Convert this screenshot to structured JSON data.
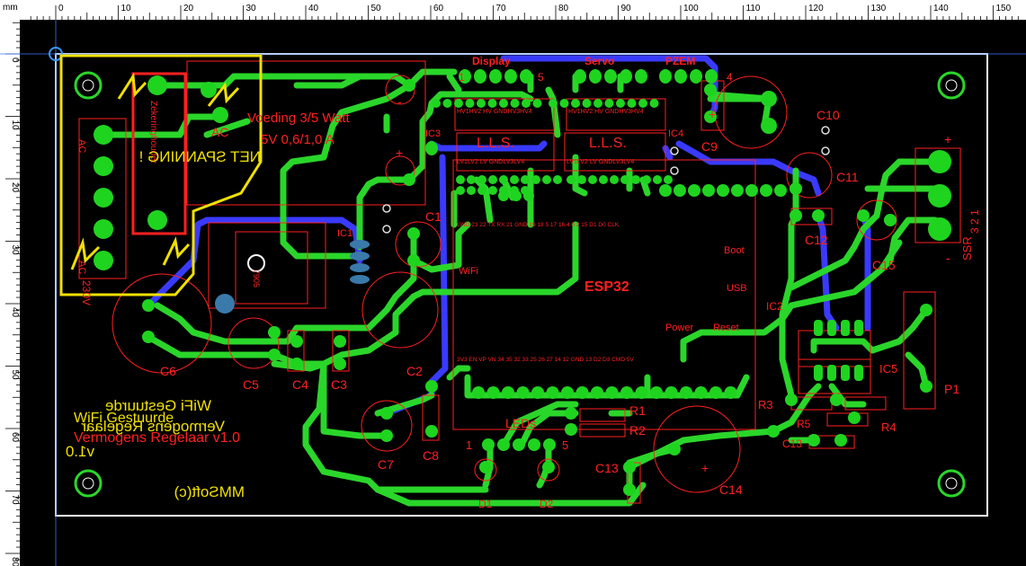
{
  "ruler": {
    "unit": "mm",
    "top_labels": [
      "0",
      "10",
      "20",
      "30",
      "40",
      "50",
      "60",
      "70",
      "80",
      "90",
      "100",
      "110",
      "120",
      "130",
      "140",
      "150"
    ],
    "left_labels": [
      "0",
      "10",
      "20",
      "30",
      "40",
      "50",
      "60",
      "70",
      "80"
    ]
  },
  "colors": {
    "background": "#000000",
    "ruler": "#ffffff",
    "board_outline": "#ffffff",
    "track_top": "#2ad62a",
    "track_bottom": "#3a3aff",
    "silkscreen": "#ff2020",
    "silkscreen_bottom": "#f0e000"
  },
  "icons": {
    "origin_marker": "crosshair-icon"
  },
  "silk": {
    "display": "Display",
    "servo": "Servo",
    "pzem": "PZEM",
    "pin1": "1",
    "pin5": "5",
    "pin4": "4",
    "voeding1": "Voeding 3/5 Watt",
    "voeding2": "5V 0,6/1,0 A",
    "ac_label": "AC",
    "ac_top": "AC",
    "ac_bottom": "AC",
    "zekering": "Zekeringhouder",
    "netspanning": "NET SPANNING !",
    "v230": "230V",
    "ic3": "IC3",
    "ic4": "IC4",
    "ic1": "IC1",
    "ic2": "IC2",
    "ic5": "IC5",
    "lls": "L.L.S.",
    "lls2": "L.L.S.",
    "hv_row": "HV1HV2 HV  GNDHV3HV4",
    "hv_row2": "HV1HV2 HV  GNDHV3HV4",
    "lv_row": "LV1LV2 LV  GNDLV3LV4",
    "lv_row2": "LV1LV2 LV  GNDLV3LV4",
    "esp32": "ESP32",
    "wifi": "WiFi",
    "boot": "Boot",
    "usb": "USB",
    "power": "Power",
    "reset": "Reset",
    "esp_top_pins": "GND  23  22  TX  RX  21  GND  19  18  5  17  16  4  0  2  15  D1  D0  CLK",
    "esp_bot_pins": "3V3 EN  VP  VN  34  35  32  33  25  26  27  14  12  GND 13  D2  D3  CMD 5V",
    "c1": "C1",
    "c2": "C2",
    "c3": "C3",
    "c4": "C4",
    "c5": "C5",
    "c6": "C6",
    "c7": "C7",
    "c8": "C8",
    "c9": "C9",
    "c10": "C10",
    "c11": "C11",
    "c12": "C12",
    "c13": "C13",
    "c14": "C14",
    "c15": "C15",
    "r1": "R1",
    "r2": "R2",
    "r3": "R3",
    "r4": "R4",
    "r5": "R5",
    "p1": "P1",
    "d1": "D1",
    "d2": "D2",
    "leds": "LEDs",
    "ssr": "SSR",
    "ssr_pins": "3  2  1",
    "plus": "+",
    "minus": "-",
    "u7905": "7905",
    "title_mirror1": "WiFi Gestuurde",
    "title_mirror2": "Vermogens Regelaar",
    "title_mirror3": "v1.0",
    "title_normal1": "WiFi Gestuurde",
    "title_normal2": "Vermogens Regelaar v1.0",
    "mmsoft": "MMSoft(c)"
  }
}
